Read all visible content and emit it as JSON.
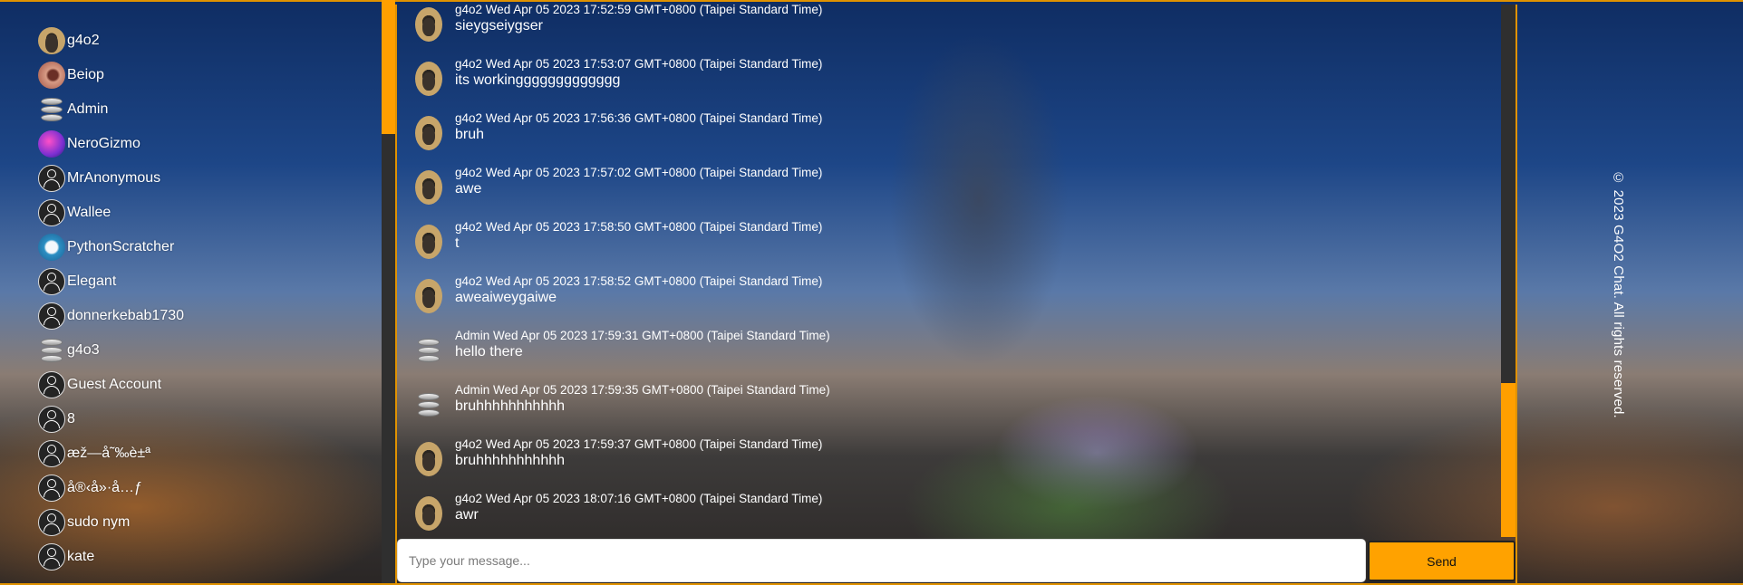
{
  "sidebar": {
    "users": [
      {
        "name": "g4o2",
        "avatar": "photo-avatar"
      },
      {
        "name": "Beiop",
        "avatar": "orange-avatar"
      },
      {
        "name": "Admin",
        "avatar": "database-avatar"
      },
      {
        "name": "NeroGizmo",
        "avatar": "purple-avatar"
      },
      {
        "name": "MrAnonymous",
        "avatar": "default-user-icon"
      },
      {
        "name": "Wallee",
        "avatar": "default-user-icon"
      },
      {
        "name": "PythonScratcher",
        "avatar": "blue-logo-avatar"
      },
      {
        "name": "Elegant",
        "avatar": "default-user-icon"
      },
      {
        "name": "donnerkebab1730",
        "avatar": "default-user-icon"
      },
      {
        "name": "g4o3",
        "avatar": "database-avatar"
      },
      {
        "name": "Guest Account",
        "avatar": "default-user-icon"
      },
      {
        "name": "8",
        "avatar": "default-user-icon"
      },
      {
        "name": "æž—å˜‰è±ª",
        "avatar": "default-user-icon"
      },
      {
        "name": "å®‹å»·å…ƒ",
        "avatar": "default-user-icon"
      },
      {
        "name": "sudo nym",
        "avatar": "default-user-icon"
      },
      {
        "name": "kate",
        "avatar": "default-user-icon"
      }
    ]
  },
  "chat": {
    "messages": [
      {
        "meta": "g4o2 Wed Apr 05 2023 17:52:59 GMT+0800 (Taipei Standard Time)",
        "text": "sieygseiygser",
        "avatar": "photo-avatar"
      },
      {
        "meta": "g4o2 Wed Apr 05 2023 17:53:07 GMT+0800 (Taipei Standard Time)",
        "text": "its workinggggggggggggg",
        "avatar": "photo-avatar"
      },
      {
        "meta": "g4o2 Wed Apr 05 2023 17:56:36 GMT+0800 (Taipei Standard Time)",
        "text": "bruh",
        "avatar": "photo-avatar"
      },
      {
        "meta": "g4o2 Wed Apr 05 2023 17:57:02 GMT+0800 (Taipei Standard Time)",
        "text": "awe",
        "avatar": "photo-avatar"
      },
      {
        "meta": "g4o2 Wed Apr 05 2023 17:58:50 GMT+0800 (Taipei Standard Time)",
        "text": "t",
        "avatar": "photo-avatar"
      },
      {
        "meta": "g4o2 Wed Apr 05 2023 17:58:52 GMT+0800 (Taipei Standard Time)",
        "text": "aweaiweygaiwe",
        "avatar": "photo-avatar"
      },
      {
        "meta": "Admin Wed Apr 05 2023 17:59:31 GMT+0800 (Taipei Standard Time)",
        "text": "hello there",
        "avatar": "database-avatar"
      },
      {
        "meta": "Admin Wed Apr 05 2023 17:59:35 GMT+0800 (Taipei Standard Time)",
        "text": "bruhhhhhhhhhhh",
        "avatar": "database-avatar"
      },
      {
        "meta": "g4o2 Wed Apr 05 2023 17:59:37 GMT+0800 (Taipei Standard Time)",
        "text": "bruhhhhhhhhhhh",
        "avatar": "photo-avatar"
      },
      {
        "meta": "g4o2 Wed Apr 05 2023 18:07:16 GMT+0800 (Taipei Standard Time)",
        "text": "awr",
        "avatar": "photo-avatar"
      }
    ],
    "input": {
      "placeholder": "Type your message...",
      "value": ""
    },
    "send_label": "Send"
  },
  "footer": {
    "copyright": "© 2023 G4O2 Chat. All rights reserved."
  },
  "colors": {
    "accent": "#ffa200",
    "scroll_thumb": "#2f2f2f",
    "border": "#e09200"
  }
}
